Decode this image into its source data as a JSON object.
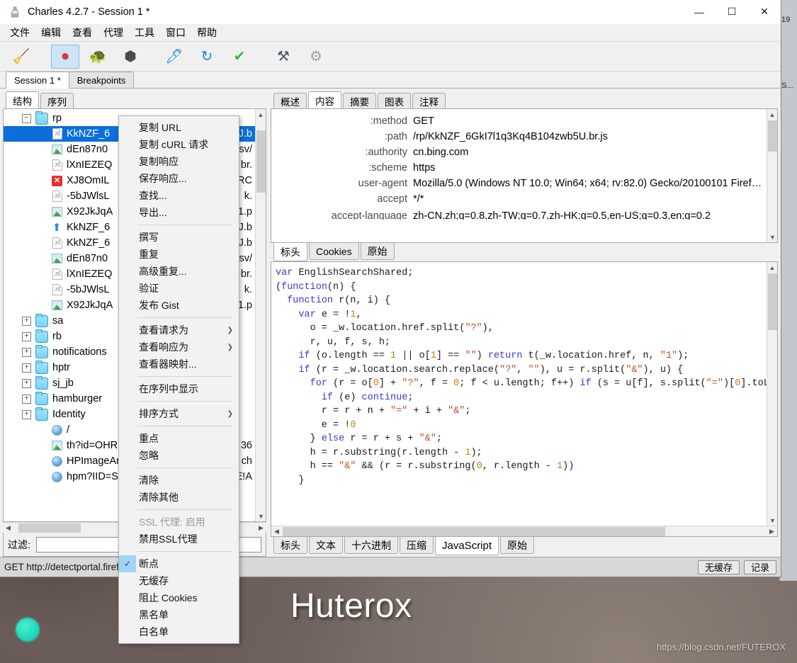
{
  "desktop": {
    "wallpaper_title": "Huterox",
    "watermark": "https://blog.csdn.net/FUTEROX"
  },
  "background_window": {
    "line1": "19",
    "line2": "S..."
  },
  "window": {
    "title": "Charles 4.2.7 - Session 1 *",
    "app_icon": "charles-bottle-icon",
    "controls": {
      "minimize": "—",
      "maximize": "☐",
      "close": "✕"
    }
  },
  "menubar": {
    "items": [
      {
        "label": "文件",
        "name": "menu-file"
      },
      {
        "label": "编辑",
        "name": "menu-edit"
      },
      {
        "label": "查看",
        "name": "menu-view"
      },
      {
        "label": "代理",
        "name": "menu-proxy"
      },
      {
        "label": "工具",
        "name": "menu-tools"
      },
      {
        "label": "窗口",
        "name": "menu-window"
      },
      {
        "label": "帮助",
        "name": "menu-help"
      }
    ]
  },
  "toolbar": {
    "buttons": [
      {
        "name": "clear-broom-icon",
        "glyph": "🧹",
        "active": false
      },
      {
        "name": "record-icon",
        "glyph": "⏺",
        "active": true
      },
      {
        "name": "throttle-turtle-icon",
        "glyph": "🐢",
        "active": false
      },
      {
        "name": "breakpoints-hex-icon",
        "glyph": "⬢",
        "active": false
      },
      {
        "name": "compose-pen-icon",
        "glyph": "🖊",
        "active": false
      },
      {
        "name": "repeat-refresh-icon",
        "glyph": "↻",
        "active": false
      },
      {
        "name": "validate-check-icon",
        "glyph": "✔",
        "active": false
      },
      {
        "name": "tools-icon",
        "glyph": "⚒",
        "active": false
      },
      {
        "name": "settings-gear-icon",
        "glyph": "⚙",
        "active": false
      }
    ]
  },
  "session_tabs": [
    {
      "label": "Session 1 *",
      "name": "tab-session-1",
      "active": true
    },
    {
      "label": "Breakpoints",
      "name": "tab-breakpoints",
      "active": false
    }
  ],
  "left_pane": {
    "tabs": [
      {
        "label": "结构",
        "name": "tab-structure",
        "active": true
      },
      {
        "label": "序列",
        "name": "tab-sequence",
        "active": false
      }
    ],
    "tree": [
      {
        "indent": 1,
        "toggle": "minus",
        "icon": "folder",
        "label": "rp",
        "selected": false,
        "right": ""
      },
      {
        "indent": 2,
        "toggle": "none",
        "icon": "doc",
        "label": "KkNZF_6",
        "selected": true,
        "right": "J.b"
      },
      {
        "indent": 2,
        "toggle": "none",
        "icon": "img",
        "label": "dEn87n0",
        "selected": false,
        "right": "sv/"
      },
      {
        "indent": 2,
        "toggle": "none",
        "icon": "doc",
        "label": "lXnIEZEQ",
        "selected": false,
        "right": "br."
      },
      {
        "indent": 2,
        "toggle": "none",
        "icon": "err",
        "label": "XJ8OmIL",
        "selected": false,
        "right": "RC"
      },
      {
        "indent": 2,
        "toggle": "none",
        "icon": "doc",
        "label": "-5bJWlsL",
        "selected": false,
        "right": "k."
      },
      {
        "indent": 2,
        "toggle": "none",
        "icon": "img",
        "label": "X92JkJqA",
        "selected": false,
        "right": "1.p"
      },
      {
        "indent": 2,
        "toggle": "none",
        "icon": "up",
        "label": "KkNZF_6",
        "selected": false,
        "right": "J.b"
      },
      {
        "indent": 2,
        "toggle": "none",
        "icon": "doc",
        "label": "KkNZF_6",
        "selected": false,
        "right": "J.b"
      },
      {
        "indent": 2,
        "toggle": "none",
        "icon": "img",
        "label": "dEn87n0",
        "selected": false,
        "right": "sv/"
      },
      {
        "indent": 2,
        "toggle": "none",
        "icon": "doc",
        "label": "lXnIEZEQ",
        "selected": false,
        "right": "br."
      },
      {
        "indent": 2,
        "toggle": "none",
        "icon": "doc",
        "label": "-5bJWlsL",
        "selected": false,
        "right": "k."
      },
      {
        "indent": 2,
        "toggle": "none",
        "icon": "img",
        "label": "X92JkJqA",
        "selected": false,
        "right": "1.p"
      },
      {
        "indent": 1,
        "toggle": "plus",
        "icon": "folder",
        "label": "sa",
        "selected": false,
        "right": ""
      },
      {
        "indent": 1,
        "toggle": "plus",
        "icon": "folder",
        "label": "rb",
        "selected": false,
        "right": ""
      },
      {
        "indent": 1,
        "toggle": "plus",
        "icon": "folder",
        "label": "notifications",
        "selected": false,
        "right": ""
      },
      {
        "indent": 1,
        "toggle": "plus",
        "icon": "folder",
        "label": "hptr",
        "selected": false,
        "right": ""
      },
      {
        "indent": 1,
        "toggle": "plus",
        "icon": "folder",
        "label": "sj_jb",
        "selected": false,
        "right": ""
      },
      {
        "indent": 1,
        "toggle": "plus",
        "icon": "folder",
        "label": "hamburger",
        "selected": false,
        "right": ""
      },
      {
        "indent": 1,
        "toggle": "plus",
        "icon": "folder",
        "label": "Identity",
        "selected": false,
        "right": ""
      },
      {
        "indent": 2,
        "toggle": "none",
        "icon": "globe",
        "label": "/",
        "selected": false,
        "right": ""
      },
      {
        "indent": 2,
        "toggle": "none",
        "icon": "img",
        "label": "th?id=OHR.",
        "selected": false,
        "right": "36"
      },
      {
        "indent": 2,
        "toggle": "none",
        "icon": "globe",
        "label": "HPImageAr",
        "selected": false,
        "right": "ch"
      },
      {
        "indent": 2,
        "toggle": "none",
        "icon": "globe",
        "label": "hpm?IID=SE",
        "selected": false,
        "right": "E!A"
      }
    ],
    "filter": {
      "label": "过滤:",
      "value": "",
      "placeholder": ""
    }
  },
  "right_pane": {
    "top_tabs": [
      {
        "label": "概述",
        "name": "tab-overview",
        "active": false
      },
      {
        "label": "内容",
        "name": "tab-contents",
        "active": true
      },
      {
        "label": "摘要",
        "name": "tab-summary",
        "active": false
      },
      {
        "label": "图表",
        "name": "tab-chart",
        "active": false
      },
      {
        "label": "注释",
        "name": "tab-notes",
        "active": false
      }
    ],
    "headers": [
      {
        "name": ":method",
        "value": "GET"
      },
      {
        "name": ":path",
        "value": "/rp/KkNZF_6GkI7l1q3Kq4B104zwb5U.br.js"
      },
      {
        "name": ":authority",
        "value": "cn.bing.com"
      },
      {
        "name": ":scheme",
        "value": "https"
      },
      {
        "name": "user-agent",
        "value": "Mozilla/5.0 (Windows NT 10.0; Win64; x64; rv:82.0) Gecko/20100101 Firef…"
      },
      {
        "name": "accept",
        "value": "*/*"
      },
      {
        "name": "accept-language",
        "value": "zh-CN,zh;q=0.8,zh-TW;q=0.7,zh-HK;q=0.5,en-US;q=0.3,en;q=0.2"
      }
    ],
    "request_tabs": [
      {
        "label": "标头",
        "name": "tab-req-headers",
        "active": true
      },
      {
        "label": "Cookies",
        "name": "tab-req-cookies",
        "active": false
      },
      {
        "label": "原始",
        "name": "tab-req-raw",
        "active": false
      }
    ],
    "code": [
      [
        {
          "t": "var ",
          "c": "kw"
        },
        {
          "t": "EnglishSearchShared;",
          "c": ""
        }
      ],
      [
        {
          "t": "(",
          "c": ""
        },
        {
          "t": "function",
          "c": "kw"
        },
        {
          "t": "(n) {",
          "c": ""
        }
      ],
      [
        {
          "t": "  function ",
          "c": "kw"
        },
        {
          "t": "r(n, i) {",
          "c": ""
        }
      ],
      [
        {
          "t": "    var ",
          "c": "kw"
        },
        {
          "t": "e = !",
          "c": ""
        },
        {
          "t": "1",
          "c": "num"
        },
        {
          "t": ",",
          "c": ""
        }
      ],
      [
        {
          "t": "      o = _w.location.href.split(",
          "c": ""
        },
        {
          "t": "\"?\"",
          "c": "str"
        },
        {
          "t": "),",
          "c": ""
        }
      ],
      [
        {
          "t": "      r, u, f, s, h;",
          "c": ""
        }
      ],
      [
        {
          "t": "    if ",
          "c": "kw"
        },
        {
          "t": "(o.length == ",
          "c": ""
        },
        {
          "t": "1",
          "c": "num"
        },
        {
          "t": " || o[",
          "c": ""
        },
        {
          "t": "1",
          "c": "num"
        },
        {
          "t": "] == ",
          "c": ""
        },
        {
          "t": "\"\"",
          "c": "str"
        },
        {
          "t": ") ",
          "c": ""
        },
        {
          "t": "return ",
          "c": "kw"
        },
        {
          "t": "t(_w.location.href, n, ",
          "c": ""
        },
        {
          "t": "\"1\"",
          "c": "str"
        },
        {
          "t": ");",
          "c": ""
        }
      ],
      [
        {
          "t": "    if ",
          "c": "kw"
        },
        {
          "t": "(r = _w.location.search.replace(",
          "c": ""
        },
        {
          "t": "\"?\"",
          "c": "str"
        },
        {
          "t": ", ",
          "c": ""
        },
        {
          "t": "\"\"",
          "c": "str"
        },
        {
          "t": "), u = r.split(",
          "c": ""
        },
        {
          "t": "\"&\"",
          "c": "str"
        },
        {
          "t": "), u) {",
          "c": ""
        }
      ],
      [
        {
          "t": "      for ",
          "c": "kw"
        },
        {
          "t": "(r = o[",
          "c": ""
        },
        {
          "t": "0",
          "c": "num"
        },
        {
          "t": "] + ",
          "c": ""
        },
        {
          "t": "\"?\"",
          "c": "str"
        },
        {
          "t": ", f = ",
          "c": ""
        },
        {
          "t": "0",
          "c": "num"
        },
        {
          "t": "; f < u.length; f++) ",
          "c": ""
        },
        {
          "t": "if ",
          "c": "kw"
        },
        {
          "t": "(s = u[f], s.split(",
          "c": ""
        },
        {
          "t": "\"=\"",
          "c": "str"
        },
        {
          "t": ")[",
          "c": ""
        },
        {
          "t": "0",
          "c": "num"
        },
        {
          "t": "].toLowerCa",
          "c": ""
        }
      ],
      [
        {
          "t": "        if ",
          "c": "kw"
        },
        {
          "t": "(e) ",
          "c": ""
        },
        {
          "t": "continue",
          "c": "kw"
        },
        {
          "t": ";",
          "c": ""
        }
      ],
      [
        {
          "t": "        r = r + n + ",
          "c": ""
        },
        {
          "t": "\"=\"",
          "c": "str"
        },
        {
          "t": " + i + ",
          "c": ""
        },
        {
          "t": "\"&\"",
          "c": "str"
        },
        {
          "t": ";",
          "c": ""
        }
      ],
      [
        {
          "t": "        e = !",
          "c": ""
        },
        {
          "t": "0",
          "c": "num"
        }
      ],
      [
        {
          "t": "      } ",
          "c": ""
        },
        {
          "t": "else ",
          "c": "kw"
        },
        {
          "t": "r = r + s + ",
          "c": ""
        },
        {
          "t": "\"&\"",
          "c": "str"
        },
        {
          "t": ";",
          "c": ""
        }
      ],
      [
        {
          "t": "      h = r.substring(r.length - ",
          "c": ""
        },
        {
          "t": "1",
          "c": "num"
        },
        {
          "t": ");",
          "c": ""
        }
      ],
      [
        {
          "t": "      h == ",
          "c": ""
        },
        {
          "t": "\"&\"",
          "c": "str"
        },
        {
          "t": " && (r = r.substring(",
          "c": ""
        },
        {
          "t": "0",
          "c": "num"
        },
        {
          "t": ", r.length - ",
          "c": ""
        },
        {
          "t": "1",
          "c": "num"
        },
        {
          "t": "))",
          "c": ""
        }
      ],
      [
        {
          "t": "    }",
          "c": ""
        }
      ]
    ],
    "response_tabs": [
      {
        "label": "标头",
        "name": "tab-res-headers",
        "active": false
      },
      {
        "label": "文本",
        "name": "tab-res-text",
        "active": false
      },
      {
        "label": "十六进制",
        "name": "tab-res-hex",
        "active": false
      },
      {
        "label": "压缩",
        "name": "tab-res-compressed",
        "active": false
      },
      {
        "label": "JavaScript",
        "name": "tab-res-javascript",
        "active": true
      },
      {
        "label": "原始",
        "name": "tab-res-raw",
        "active": false
      }
    ]
  },
  "statusbar": {
    "text": "GET http://detectportal.firef",
    "buttons": [
      {
        "label": "无缓存",
        "name": "statusbar-no-caching-button"
      },
      {
        "label": "记录",
        "name": "statusbar-recording-button"
      }
    ]
  },
  "context_menu": [
    {
      "type": "item",
      "label": "复制 URL",
      "name": "ctx-copy-url"
    },
    {
      "type": "item",
      "label": "复制 cURL 请求",
      "name": "ctx-copy-curl-request"
    },
    {
      "type": "item",
      "label": "复制响应",
      "name": "ctx-copy-response"
    },
    {
      "type": "item",
      "label": "保存响应...",
      "name": "ctx-save-response"
    },
    {
      "type": "item",
      "label": "查找...",
      "name": "ctx-find"
    },
    {
      "type": "item",
      "label": "导出...",
      "name": "ctx-export"
    },
    {
      "type": "sep"
    },
    {
      "type": "item",
      "label": "撰写",
      "name": "ctx-compose"
    },
    {
      "type": "item",
      "label": "重复",
      "name": "ctx-repeat"
    },
    {
      "type": "item",
      "label": "高级重复...",
      "name": "ctx-advanced-repeat"
    },
    {
      "type": "item",
      "label": "验证",
      "name": "ctx-validate"
    },
    {
      "type": "item",
      "label": "发布 Gist",
      "name": "ctx-publish-gist"
    },
    {
      "type": "sep"
    },
    {
      "type": "item",
      "label": "查看请求为",
      "name": "ctx-view-request-as",
      "arrow": true
    },
    {
      "type": "item",
      "label": "查看响应为",
      "name": "ctx-view-response-as",
      "arrow": true
    },
    {
      "type": "item",
      "label": "查看器映射...",
      "name": "ctx-viewer-mapping"
    },
    {
      "type": "sep"
    },
    {
      "type": "item",
      "label": "在序列中显示",
      "name": "ctx-show-in-sequence"
    },
    {
      "type": "sep"
    },
    {
      "type": "item",
      "label": "排序方式",
      "name": "ctx-sort-by",
      "arrow": true
    },
    {
      "type": "sep"
    },
    {
      "type": "item",
      "label": "重点",
      "name": "ctx-focus"
    },
    {
      "type": "item",
      "label": "忽略",
      "name": "ctx-ignore"
    },
    {
      "type": "sep"
    },
    {
      "type": "item",
      "label": "清除",
      "name": "ctx-clear"
    },
    {
      "type": "item",
      "label": "清除其他",
      "name": "ctx-clear-other"
    },
    {
      "type": "sep"
    },
    {
      "type": "item",
      "label": "SSL 代理: 启用",
      "name": "ctx-ssl-proxy-enabled",
      "disabled": true
    },
    {
      "type": "item",
      "label": "禁用SSL代理",
      "name": "ctx-disable-ssl-proxy"
    },
    {
      "type": "sep"
    },
    {
      "type": "item",
      "label": "断点",
      "name": "ctx-breakpoints",
      "checked": true
    },
    {
      "type": "item",
      "label": "无缓存",
      "name": "ctx-no-caching"
    },
    {
      "type": "item",
      "label": "阻止 Cookies",
      "name": "ctx-block-cookies"
    },
    {
      "type": "item",
      "label": "黑名单",
      "name": "ctx-blocklist"
    },
    {
      "type": "item",
      "label": "白名单",
      "name": "ctx-allowlist"
    }
  ]
}
